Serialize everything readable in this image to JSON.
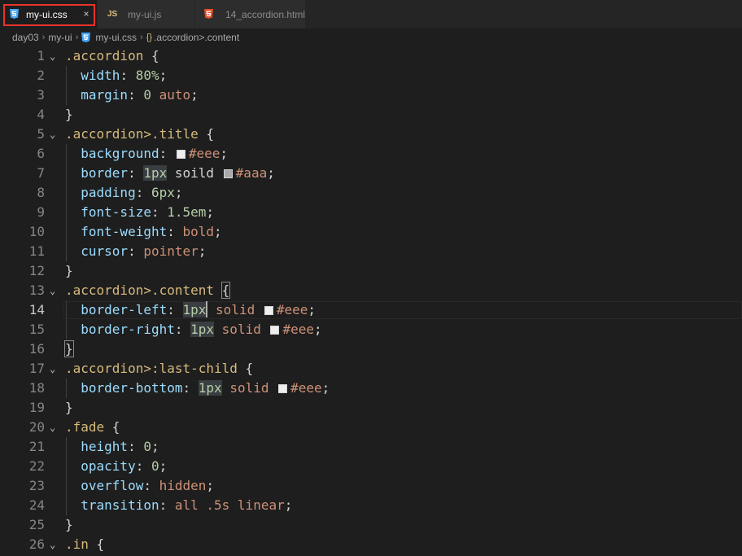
{
  "tabs": [
    {
      "label": "my-ui.css",
      "icon": "css-file-icon",
      "active": true
    },
    {
      "label": "my-ui.js",
      "icon": "js-file-icon",
      "active": false
    },
    {
      "label": "14_accordion.html",
      "icon": "html-file-icon",
      "active": false
    }
  ],
  "tab_close_glyph": "×",
  "breadcrumb": {
    "folder1": "day03",
    "folder2": "my-ui",
    "file": "my-ui.css",
    "symbol": ".accordion>.content"
  },
  "editor": {
    "current_line": 14,
    "lines": [
      {
        "n": "1",
        "fold": true
      },
      {
        "n": "2"
      },
      {
        "n": "3"
      },
      {
        "n": "4"
      },
      {
        "n": "5",
        "fold": true
      },
      {
        "n": "6"
      },
      {
        "n": "7"
      },
      {
        "n": "8"
      },
      {
        "n": "9"
      },
      {
        "n": "10"
      },
      {
        "n": "11"
      },
      {
        "n": "12"
      },
      {
        "n": "13",
        "fold": true
      },
      {
        "n": "14"
      },
      {
        "n": "15"
      },
      {
        "n": "16"
      },
      {
        "n": "17",
        "fold": true
      },
      {
        "n": "18"
      },
      {
        "n": "19"
      },
      {
        "n": "20",
        "fold": true
      },
      {
        "n": "21"
      },
      {
        "n": "22"
      },
      {
        "n": "23"
      },
      {
        "n": "24"
      },
      {
        "n": "25"
      },
      {
        "n": "26",
        "fold": true
      }
    ],
    "tokens": {
      "l1": [
        ".accordion",
        " {"
      ],
      "l2": [
        "width",
        ": ",
        "80%",
        ";"
      ],
      "l3": [
        "margin",
        ": ",
        "0",
        " ",
        "auto",
        ";"
      ],
      "l4": [
        "}"
      ],
      "l5": [
        ".accordion>.title",
        " {"
      ],
      "l6": [
        "background",
        ": ",
        "#eee",
        ";"
      ],
      "l7": [
        "border",
        ": ",
        "1px",
        " soild ",
        "#aaa",
        ";"
      ],
      "l8": [
        "padding",
        ": ",
        "6px",
        ";"
      ],
      "l9": [
        "font-size",
        ": ",
        "1.5em",
        ";"
      ],
      "l10": [
        "font-weight",
        ": ",
        "bold",
        ";"
      ],
      "l11": [
        "cursor",
        ": ",
        "pointer",
        ";"
      ],
      "l12": [
        "}"
      ],
      "l13": [
        ".accordion>.content",
        " ",
        "{"
      ],
      "l14": [
        "border-left",
        ": ",
        "1px",
        " ",
        "solid",
        " ",
        "#eee",
        ";"
      ],
      "l15": [
        "border-right",
        ": ",
        "1px",
        " ",
        "solid",
        " ",
        "#eee",
        ";"
      ],
      "l16": [
        "}"
      ],
      "l17": [
        ".accordion>:last-child",
        " {"
      ],
      "l18": [
        "border-bottom",
        ": ",
        "1px",
        " ",
        "solid",
        " ",
        "#eee",
        ";"
      ],
      "l19": [
        "}"
      ],
      "l20": [
        ".fade",
        " {"
      ],
      "l21": [
        "height",
        ": ",
        "0",
        ";"
      ],
      "l22": [
        "opacity",
        ": ",
        "0",
        ";"
      ],
      "l23": [
        "overflow",
        ": ",
        "hidden",
        ";"
      ],
      "l24": [
        "transition",
        ": ",
        "all .5s linear",
        ";"
      ],
      "l25": [
        "}"
      ],
      "l26": [
        ".in",
        " {"
      ]
    }
  },
  "colors": {
    "swatch_eee": "#eeeeee",
    "swatch_aaa": "#aaaaaa",
    "tab_outline": "#e8322b"
  }
}
